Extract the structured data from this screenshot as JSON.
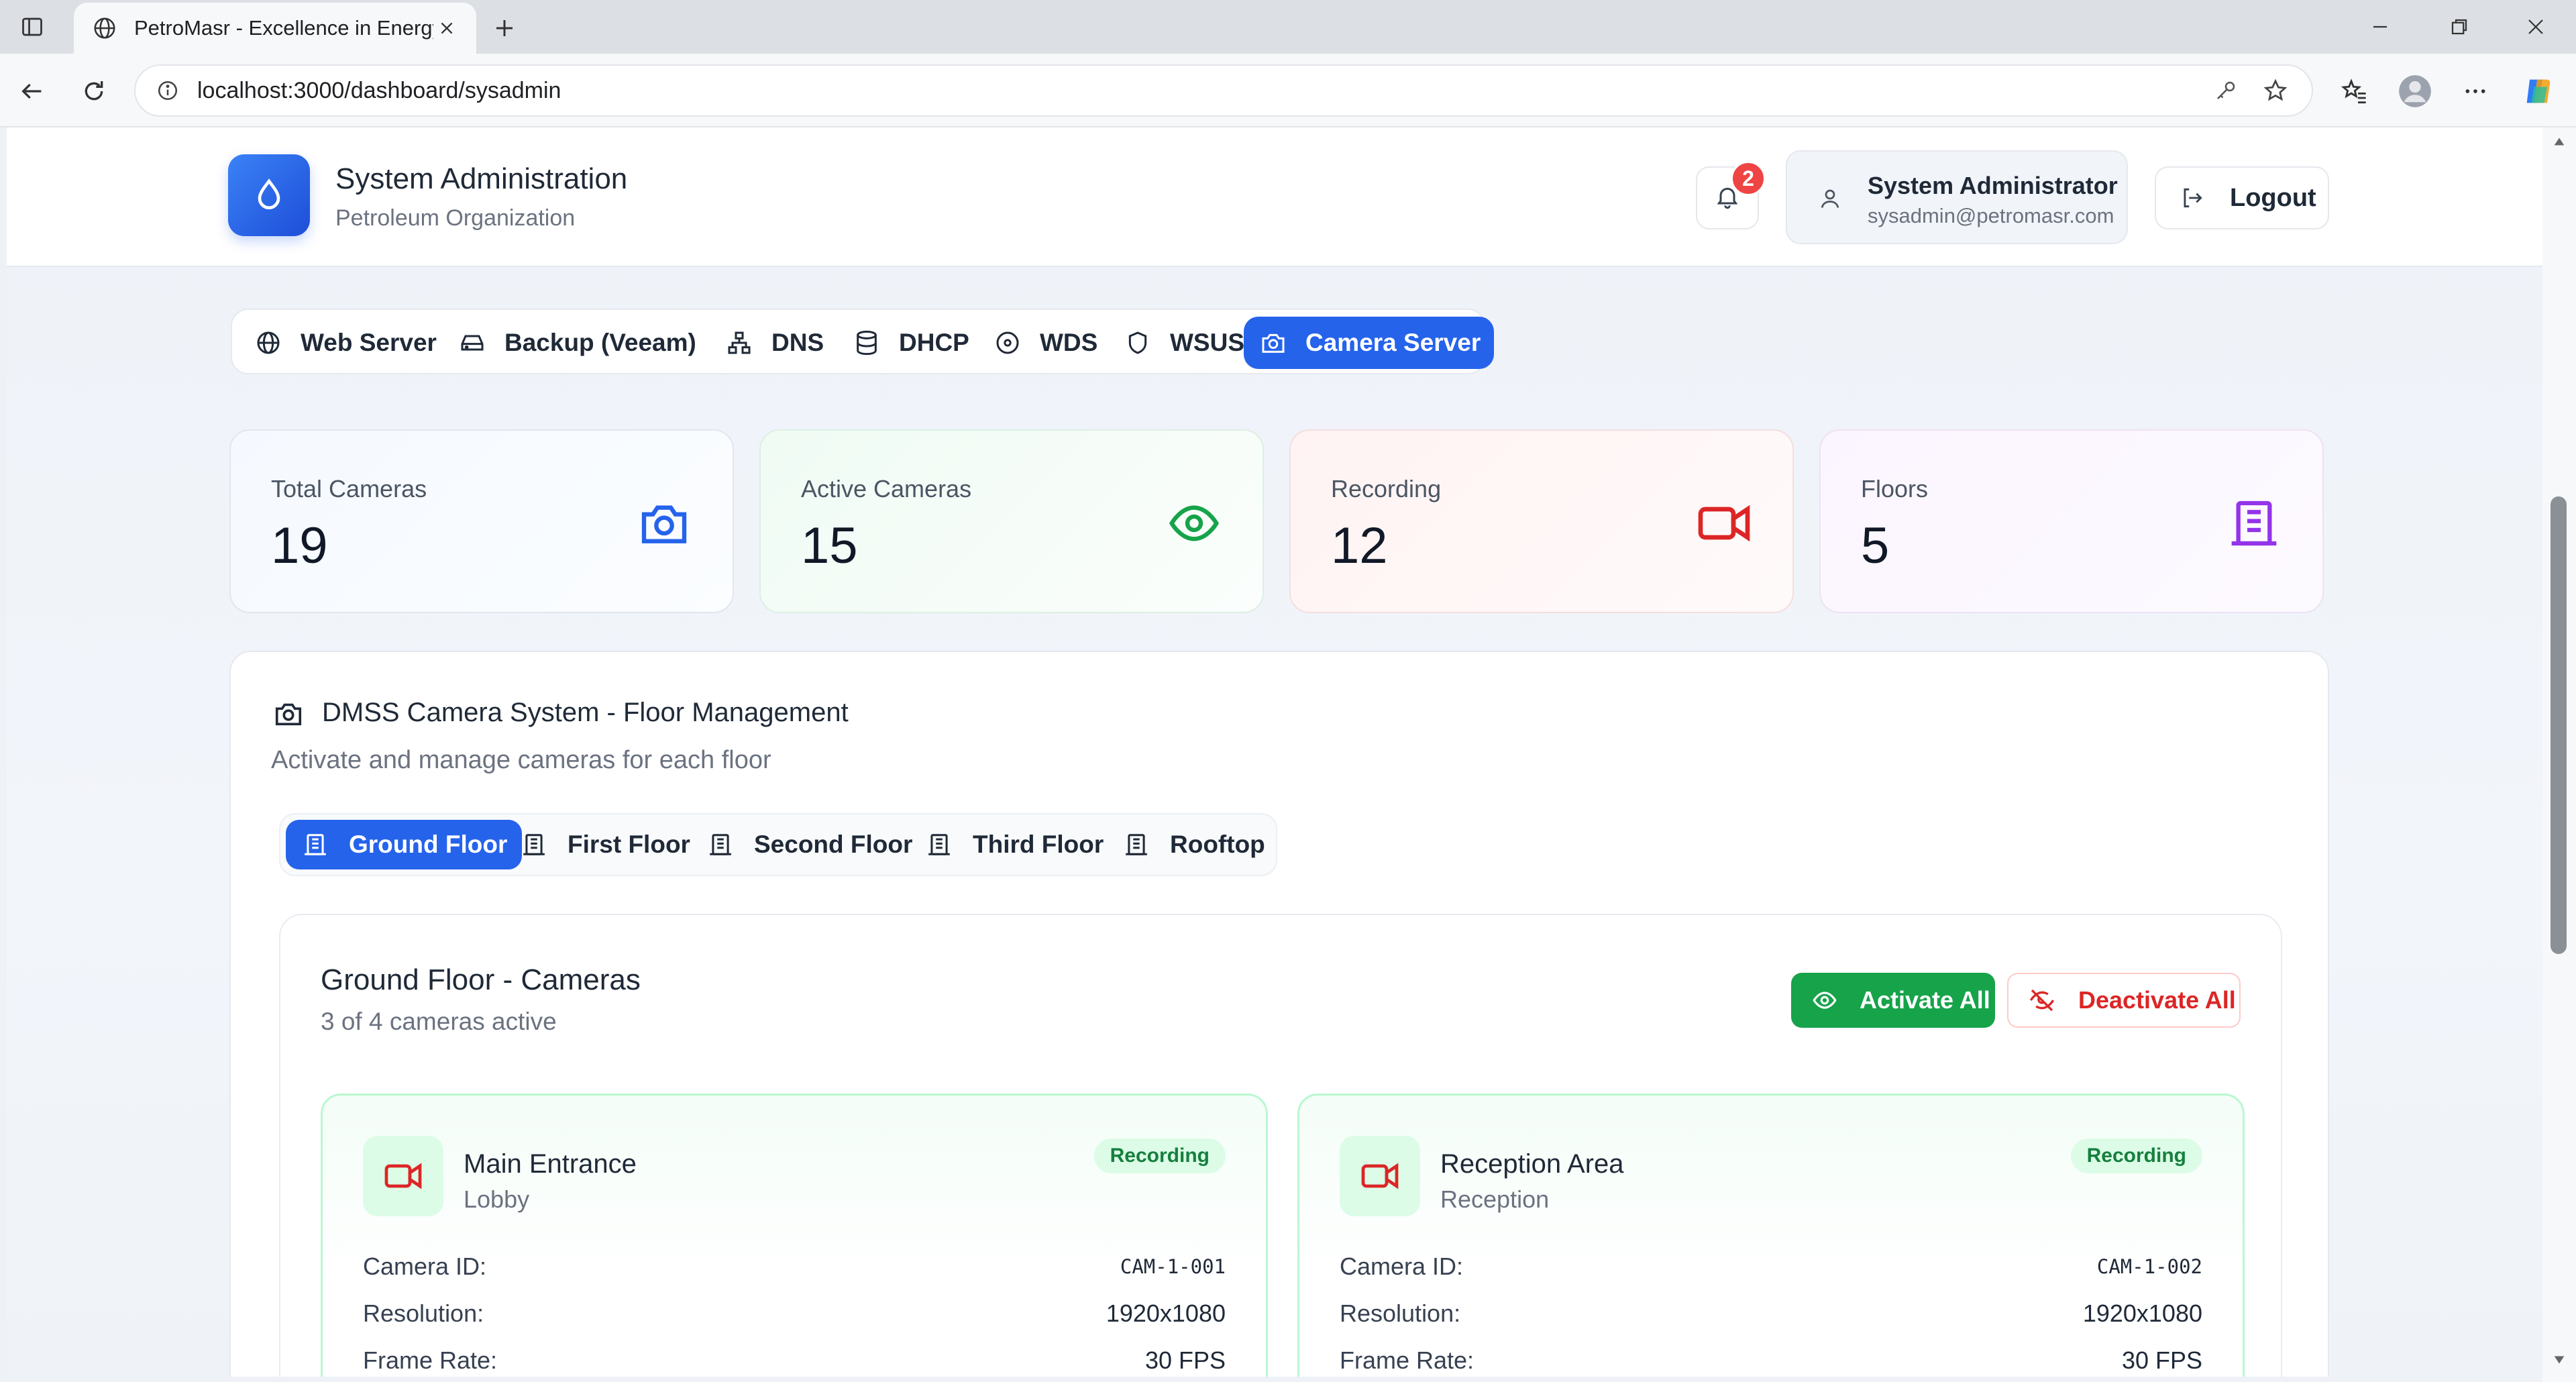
{
  "browser": {
    "tab_title": "PetroMasr - Excellence in Energy",
    "url": "localhost:3000/dashboard/sysadmin"
  },
  "header": {
    "title": "System Administration",
    "subtitle": "Petroleum Organization",
    "notification_count": "2",
    "user_name": "System Administrator",
    "user_email": "sysadmin@petromasr.com",
    "logout_label": "Logout"
  },
  "services": [
    {
      "label": "Web Server",
      "icon": "globe-icon"
    },
    {
      "label": "Backup (Veeam)",
      "icon": "hard-drive-icon"
    },
    {
      "label": "DNS",
      "icon": "network-icon"
    },
    {
      "label": "DHCP",
      "icon": "database-icon"
    },
    {
      "label": "WDS",
      "icon": "disc-icon"
    },
    {
      "label": "WSUS",
      "icon": "shield-icon"
    },
    {
      "label": "Camera Server",
      "icon": "camera-icon",
      "active": true
    }
  ],
  "stats": [
    {
      "label": "Total Cameras",
      "value": "19",
      "icon": "camera-icon",
      "color": "#2563eb"
    },
    {
      "label": "Active Cameras",
      "value": "15",
      "icon": "eye-icon",
      "color": "#16a34a"
    },
    {
      "label": "Recording",
      "value": "12",
      "icon": "video-icon",
      "color": "#dc2626"
    },
    {
      "label": "Floors",
      "value": "5",
      "icon": "building-icon",
      "color": "#9333ea"
    }
  ],
  "camera_system": {
    "title": "DMSS Camera System - Floor Management",
    "subtitle": "Activate and manage cameras for each floor",
    "floors": [
      "Ground Floor",
      "First Floor",
      "Second Floor",
      "Third Floor",
      "Rooftop"
    ],
    "selected_floor": "Ground Floor",
    "panel_title": "Ground Floor - Cameras",
    "panel_subtitle": "3 of 4 cameras active",
    "activate_all": "Activate All",
    "deactivate_all": "Deactivate All",
    "field_labels": {
      "camera_id": "Camera ID:",
      "resolution": "Resolution:",
      "frame_rate": "Frame Rate:"
    },
    "cameras": [
      {
        "name": "Main Entrance",
        "location": "Lobby",
        "status": "Recording",
        "camera_id": "CAM-1-001",
        "resolution": "1920x1080",
        "frame_rate": "30 FPS"
      },
      {
        "name": "Reception Area",
        "location": "Reception",
        "status": "Recording",
        "camera_id": "CAM-1-002",
        "resolution": "1920x1080",
        "frame_rate": "30 FPS"
      }
    ]
  },
  "colors": {
    "primary": "#2563eb",
    "success": "#16a34a",
    "danger": "#dc2626",
    "purple": "#9333ea"
  }
}
